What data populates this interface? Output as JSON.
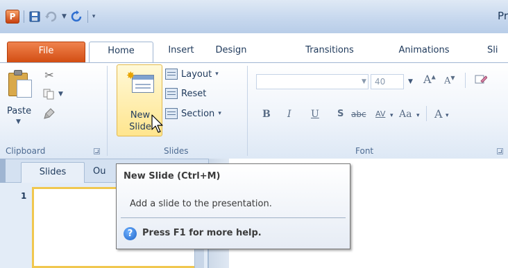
{
  "app": {
    "logo_letter": "P",
    "title_fragment": "Pr",
    "accent_color": "#d24d12",
    "highlight_color": "#ffe58e"
  },
  "quick_access": {
    "icons": [
      "save-icon",
      "undo-icon",
      "redo-icon",
      "customize-dropdown-icon"
    ]
  },
  "tabs": [
    {
      "label": "File",
      "active": false
    },
    {
      "label": "Home",
      "active": true
    },
    {
      "label": "Insert",
      "active": false
    },
    {
      "label": "Design",
      "active": false
    },
    {
      "label": "Transitions",
      "active": false
    },
    {
      "label": "Animations",
      "active": false
    },
    {
      "label": "Sli",
      "active": false
    }
  ],
  "ribbon": {
    "clipboard": {
      "label": "Clipboard",
      "paste_label": "Paste",
      "icons": [
        "cut-icon",
        "copy-icon",
        "format-painter-icon"
      ]
    },
    "slides": {
      "label": "Slides",
      "new_slide_line1": "New",
      "new_slide_line2": "Slide",
      "layout_label": "Layout",
      "reset_label": "Reset",
      "section_label": "Section"
    },
    "font": {
      "label": "Font",
      "font_name": "",
      "font_size": "40",
      "buttons": [
        "B",
        "I",
        "U",
        "S",
        "abc",
        "AV",
        "Aa",
        "A"
      ]
    }
  },
  "pane": {
    "tab_slides": "Slides",
    "tab_outline": "Ou",
    "slide_number": "1"
  },
  "tooltip": {
    "title": "New Slide (Ctrl+M)",
    "body": "Add a slide to the presentation.",
    "help": "Press F1 for more help."
  }
}
